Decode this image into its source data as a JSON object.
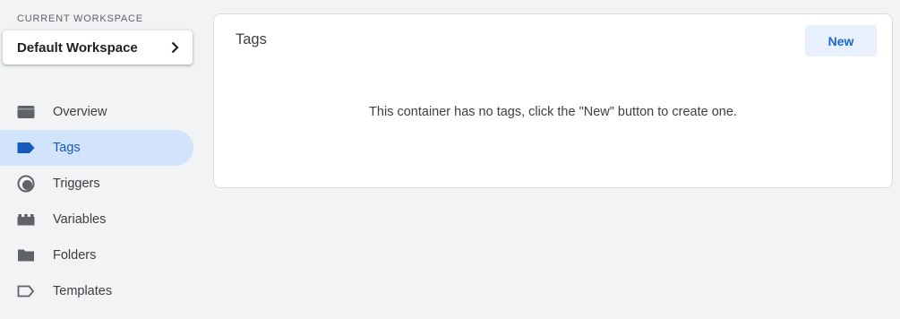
{
  "workspace": {
    "section_label": "CURRENT WORKSPACE",
    "name": "Default Workspace"
  },
  "nav": {
    "items": [
      {
        "label": "Overview",
        "icon": "overview-icon"
      },
      {
        "label": "Tags",
        "icon": "tag-icon",
        "active": true
      },
      {
        "label": "Triggers",
        "icon": "trigger-icon"
      },
      {
        "label": "Variables",
        "icon": "variables-icon"
      },
      {
        "label": "Folders",
        "icon": "folder-icon"
      },
      {
        "label": "Templates",
        "icon": "template-icon"
      }
    ]
  },
  "main": {
    "title": "Tags",
    "new_button_label": "New",
    "empty_message": "This container has no tags, click the \"New\" button to create one."
  },
  "colors": {
    "background": "#f1f3f4",
    "active_nav_bg": "#d2e3fc",
    "accent": "#1967d2",
    "button_bg": "#e8f0fe"
  }
}
